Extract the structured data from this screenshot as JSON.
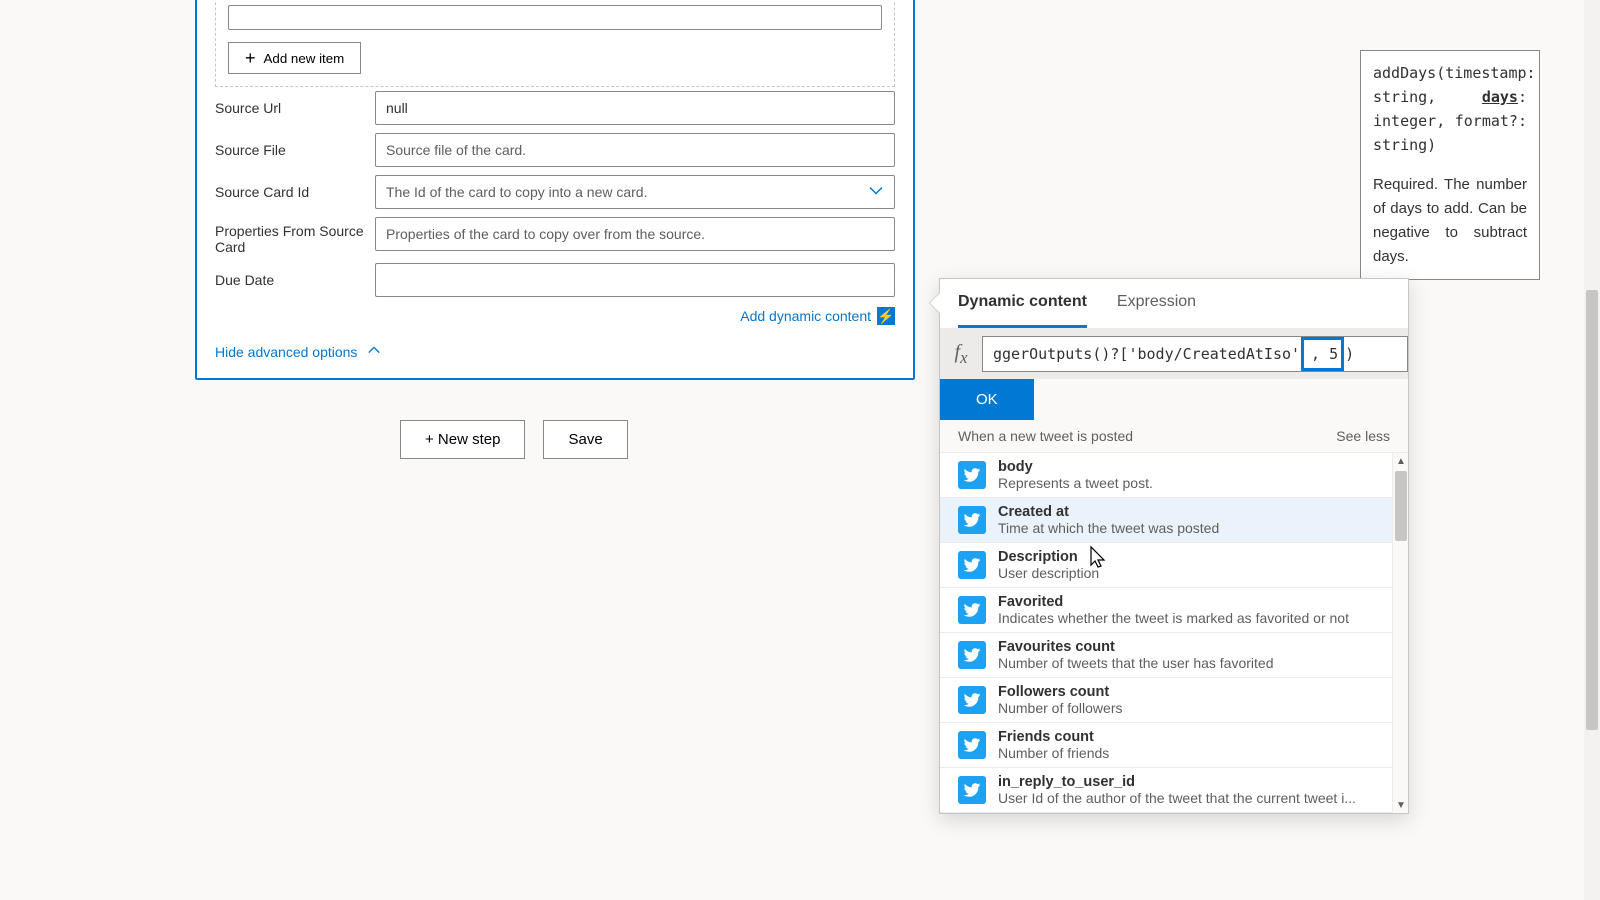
{
  "card": {
    "add_item_label": "Add new item",
    "fields": {
      "source_url": {
        "label": "Source Url",
        "value": "null"
      },
      "source_file": {
        "label": "Source File",
        "placeholder": "Source file of the card."
      },
      "source_card_id": {
        "label": "Source Card Id",
        "placeholder": "The Id of the card to copy into a new card."
      },
      "props_from_src": {
        "label": "Properties From Source Card",
        "placeholder": "Properties of the card to copy over from the source."
      },
      "due_date": {
        "label": "Due Date",
        "placeholder": ""
      }
    },
    "add_dynamic": "Add dynamic content",
    "hide_advanced": "Hide advanced options"
  },
  "buttons": {
    "new_step": "+ New step",
    "save": "Save"
  },
  "tooltip": {
    "sig_prefix": "addDays(timestamp: string, ",
    "sig_param": "days",
    "sig_suffix": ": integer, format?: string)",
    "desc": "Required. The number of days to add. Can be negative to subtract days."
  },
  "flyout": {
    "tabs": {
      "dynamic": "Dynamic content",
      "expression": "Expression"
    },
    "expression_prefix": "ggerOutputs()?['body/CreatedAtIso'",
    "expression_boxed": ", 5",
    "expression_suffix": ")",
    "ok": "OK",
    "section_title": "When a new tweet is posted",
    "see_less": "See less",
    "items": [
      {
        "title": "body",
        "desc": "Represents a tweet post."
      },
      {
        "title": "Created at",
        "desc": "Time at which the tweet was posted"
      },
      {
        "title": "Description",
        "desc": "User description"
      },
      {
        "title": "Favorited",
        "desc": "Indicates whether the tweet is marked as favorited or not"
      },
      {
        "title": "Favourites count",
        "desc": "Number of tweets that the user has favorited"
      },
      {
        "title": "Followers count",
        "desc": "Number of followers"
      },
      {
        "title": "Friends count",
        "desc": "Number of friends"
      },
      {
        "title": "in_reply_to_user_id",
        "desc": "User Id of the author of the tweet that the current tweet i..."
      }
    ]
  }
}
